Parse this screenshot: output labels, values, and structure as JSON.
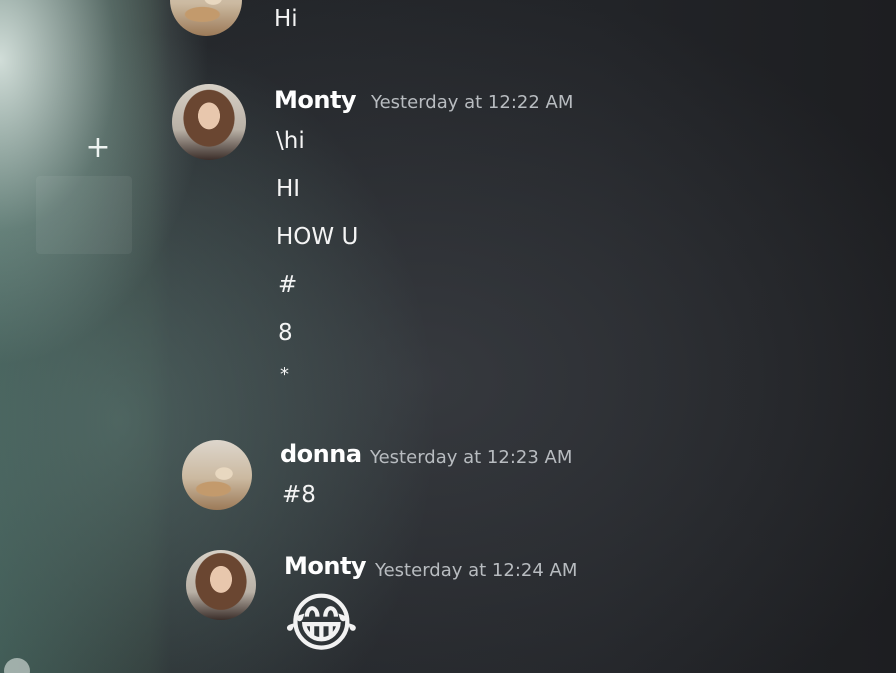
{
  "messages": [
    {
      "author": "",
      "timestamp": "",
      "lines": [
        "Hi"
      ]
    },
    {
      "author": "Monty",
      "timestamp": "Yesterday at 12:22 AM",
      "lines": [
        "\\hi",
        "HI",
        "HOW U",
        "#",
        "8",
        "*"
      ]
    },
    {
      "author": "donna",
      "timestamp": "Yesterday at 12:23 AM",
      "lines": [
        "#8"
      ]
    },
    {
      "author": "Monty",
      "timestamp": "Yesterday at 12:24 AM",
      "emoji": "😂"
    }
  ],
  "server_rail": {
    "add_server_icon": "+"
  },
  "icons": {
    "add": "plus-icon"
  }
}
